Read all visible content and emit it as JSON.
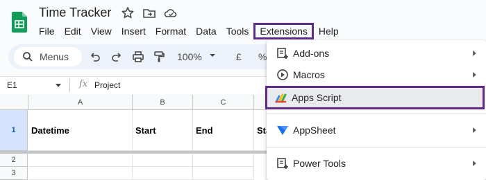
{
  "app": {
    "title": "Time Tracker"
  },
  "menu": {
    "items": [
      "File",
      "Edit",
      "View",
      "Insert",
      "Format",
      "Data",
      "Tools",
      "Extensions",
      "Help"
    ],
    "active": "Extensions"
  },
  "toolbar": {
    "search_label": "Menus",
    "zoom": "100%",
    "currency": "£",
    "percent": "%"
  },
  "formula_bar": {
    "cell_ref": "E1",
    "fx_label": "fx",
    "value": "Project"
  },
  "grid": {
    "columns": [
      "A",
      "B",
      "C"
    ],
    "rows": [
      "1",
      "2",
      "3"
    ],
    "row1": [
      "Datetime",
      "Start",
      "End",
      "Sta"
    ]
  },
  "extensions_menu": {
    "items": [
      {
        "label": "Add-ons",
        "icon": "addons-icon",
        "has_submenu": true
      },
      {
        "label": "Macros",
        "icon": "macros-icon",
        "has_submenu": true
      },
      {
        "label": "Apps Script",
        "icon": "apps-script-icon",
        "has_submenu": false,
        "highlighted": true
      },
      {
        "label": "AppSheet",
        "icon": "appsheet-icon",
        "has_submenu": true
      },
      {
        "label": "Power Tools",
        "icon": "power-tools-icon",
        "has_submenu": true
      }
    ]
  },
  "colors": {
    "highlight_border": "#5f2a8c",
    "sheets_green": "#0f9d58",
    "appsheet_blue": "#1a73e8",
    "selected_row_header": "#d3e3fd"
  }
}
